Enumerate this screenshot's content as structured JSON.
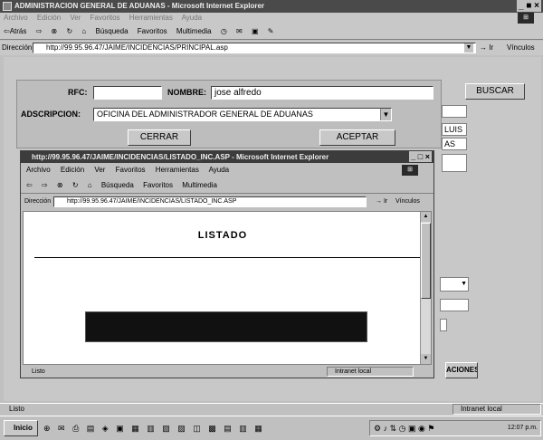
{
  "window": {
    "title": "ADMINISTRACION GENERAL DE ADUANAS - Microsoft Internet Explorer",
    "controls": "_ ■ ×"
  },
  "menu": [
    "Archivo",
    "Edición",
    "Ver",
    "Favoritos",
    "Herramientas",
    "Ayuda"
  ],
  "toolbar": {
    "back": "⇦Atrás",
    "forward": "⇨",
    "stop": "⊗",
    "refresh": "↻",
    "home": "⌂",
    "search": "Búsqueda",
    "favorites": "Favoritos",
    "multimedia": "Multimedia",
    "history": "◷",
    "mail": "✉",
    "print": "▣",
    "edit": "✎"
  },
  "address": {
    "label": "Dirección",
    "url": "http://99.95.96.47/JAIME/INCIDENCIAS/PRINCIPAL.asp",
    "go": "Ir",
    "links": "Vínculos"
  },
  "background": {
    "buscar_label": "BUSCAR",
    "luis": "LUIS",
    "as": "AS",
    "opciones_label": "ACIONES"
  },
  "search_panel": {
    "rfc_label": "RFC:",
    "rfc_value": "",
    "nombre_label": "NOMBRE:",
    "nombre_value": "jose alfredo",
    "adscripcion_label": "ADSCRIPCION:",
    "adscripcion_value": "OFICINA DEL ADMINISTRADOR GENERAL DE ADUANAS",
    "cerrar_label": "CERRAR",
    "aceptar_label": "ACEPTAR"
  },
  "popup": {
    "title": "http://99.95.96.47/JAIME/INCIDENCIAS/LISTADO_INC.ASP - Microsoft Internet Explorer",
    "controls": "_ □ ×",
    "menu": [
      "Archivo",
      "Edición",
      "Ver",
      "Favoritos",
      "Herramientas",
      "Ayuda"
    ],
    "toolbar": {
      "back": "⇦",
      "forward": "⇨",
      "stop": "⊗",
      "refresh": "↻",
      "home": "⌂",
      "search": "Búsqueda",
      "favorites": "Favoritos",
      "multimedia": "Multimedia"
    },
    "address": {
      "label": "Dirección",
      "url": "http://99.95.96.47/JAIME/INCIDENCIAS/LISTADO_INC.ASP",
      "go": "Ir",
      "links": "Vínculos"
    },
    "heading": "LISTADO",
    "status": "Listo",
    "zone": "Intranet local"
  },
  "status": {
    "text": "Listo",
    "zone": "Intranet local"
  },
  "taskbar": {
    "start": "Inicio",
    "quick_icons": "⊕ ✉ ⎙ ▤ ◈ ▣ ▦ ▥ ▧ ▨ ◫ ▩ ▤ ▥ ▦",
    "tray_icons": "⚙ ♪ ⇅ ◷ ▣ ◉ ⚑",
    "clock": "12:07 p.m."
  }
}
